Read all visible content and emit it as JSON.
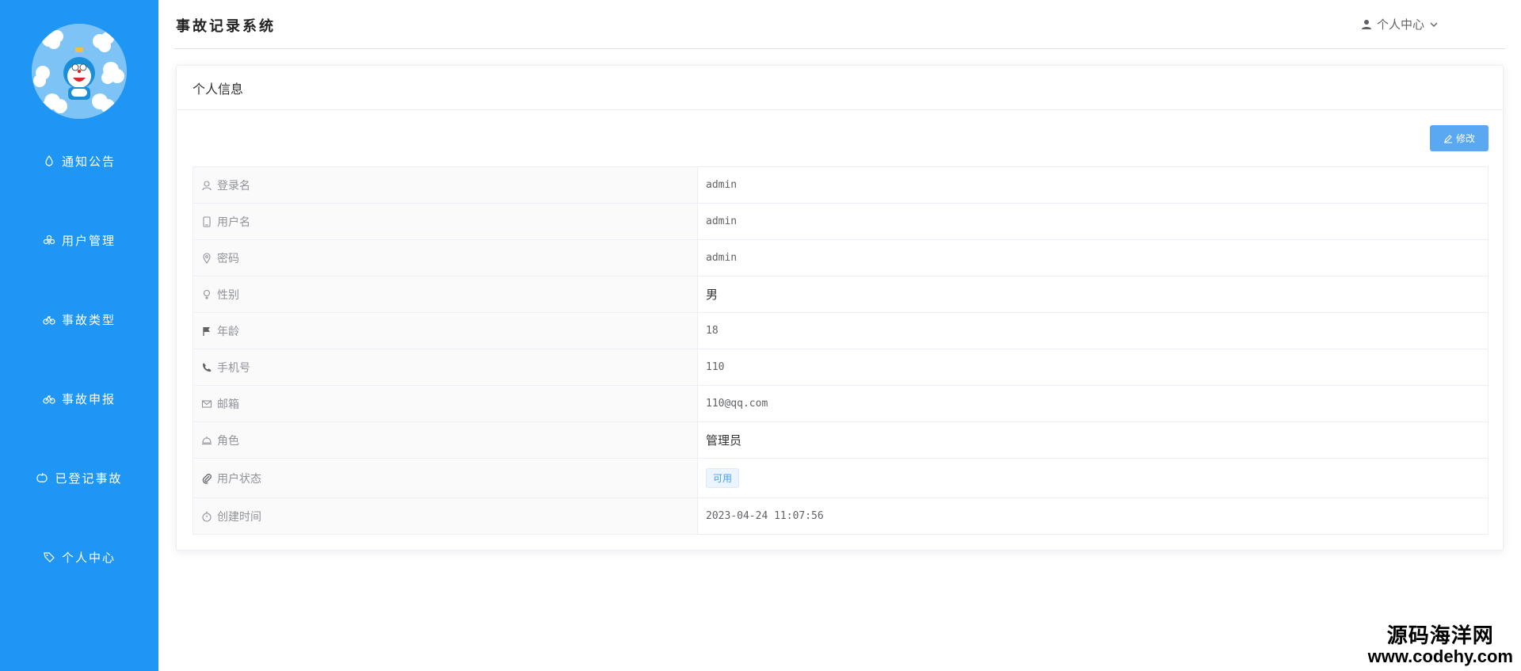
{
  "app": {
    "title": "事故记录系统"
  },
  "header": {
    "user_menu_label": "个人中心"
  },
  "sidebar": {
    "items": [
      {
        "label": "通知公告",
        "icon": "droplet-icon"
      },
      {
        "label": "用户管理",
        "icon": "user-group-icon"
      },
      {
        "label": "事故类型",
        "icon": "bicycle-icon"
      },
      {
        "label": "事故申报",
        "icon": "bicycle-icon"
      },
      {
        "label": "已登记事故",
        "icon": "apple-icon"
      },
      {
        "label": "个人中心",
        "icon": "tag-icon"
      }
    ]
  },
  "card": {
    "title": "个人信息",
    "edit_label": "修改",
    "rows": [
      {
        "label": "登录名",
        "value": "admin",
        "icon": "user-icon"
      },
      {
        "label": "用户名",
        "value": "admin",
        "icon": "mobile-icon"
      },
      {
        "label": "密码",
        "value": "admin",
        "icon": "location-icon"
      },
      {
        "label": "性别",
        "value": "男",
        "icon": "female-icon"
      },
      {
        "label": "年龄",
        "value": "18",
        "icon": "flag-icon"
      },
      {
        "label": "手机号",
        "value": "110",
        "icon": "phone-icon"
      },
      {
        "label": "邮箱",
        "value": "110@qq.com",
        "icon": "message-icon"
      },
      {
        "label": "角色",
        "value": "管理员",
        "icon": "bell-icon"
      },
      {
        "label": "用户状态",
        "value": "可用",
        "icon": "paperclip-icon"
      },
      {
        "label": "创建时间",
        "value": "2023-04-24 11:07:56",
        "icon": "timer-icon"
      }
    ]
  },
  "watermark": {
    "line1": "源码海洋网",
    "line2": "www.codehy.com"
  },
  "colors": {
    "sidebar_bg": "#1f96f3",
    "primary_button": "#5aa8f2",
    "tag_text": "#409eff"
  }
}
